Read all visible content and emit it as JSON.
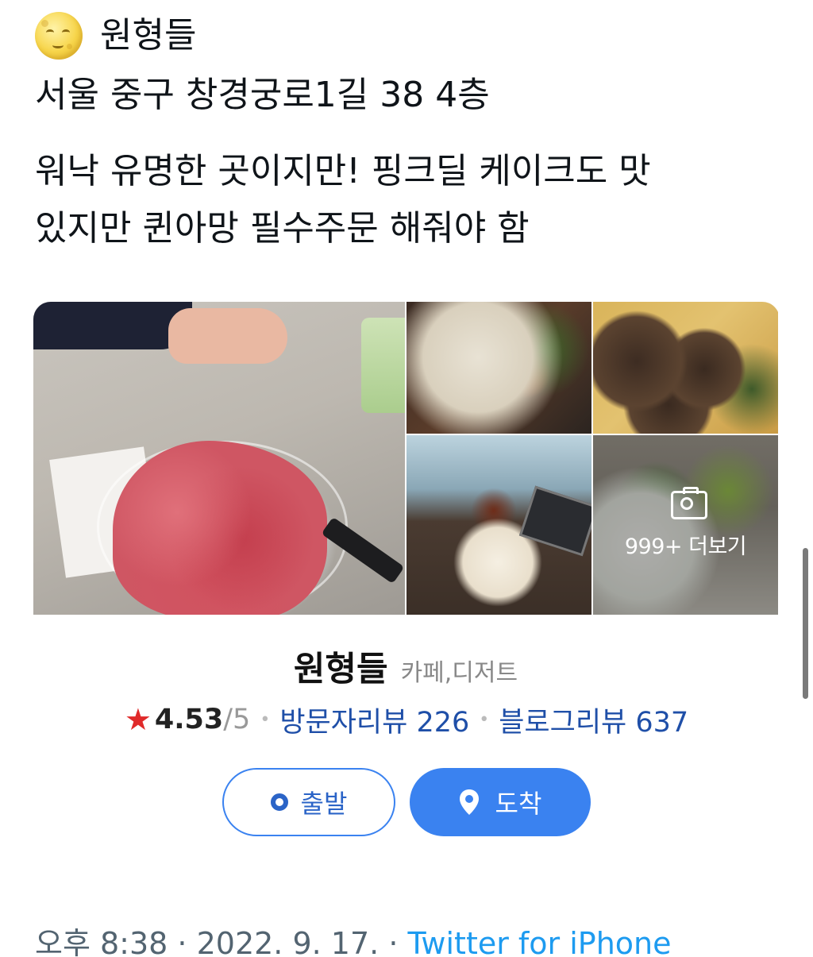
{
  "tweet": {
    "line1": "원형들",
    "address": "서울 중구 창경궁로1길 38 4층",
    "body_line1": "워낙 유명한 곳이지만! 핑크딜 케이크도 맛",
    "body_line2": "있지만 퀸아망 필수주문 해줘야 함"
  },
  "card": {
    "more_label": "999+ 더보기",
    "place_name": "원형들",
    "category": "카페,디저트",
    "rating": "4.53",
    "rating_max": "/5",
    "visitor_reviews": "방문자리뷰 226",
    "blog_reviews": "블로그리뷰 637",
    "start_label": "출발",
    "arrive_label": "도착"
  },
  "meta": {
    "time": "오후 8:38",
    "sep1": " · ",
    "date": "2022. 9. 17.",
    "sep2": " · ",
    "source": "Twitter for iPhone"
  },
  "icons": {
    "emoji": "full-moon-face-icon",
    "star": "star-icon",
    "camera": "camera-icon",
    "origin": "origin-marker-icon",
    "pin": "map-pin-icon"
  },
  "colors": {
    "accent_blue": "#3a82f0",
    "review_blue": "#1f4fa8",
    "star_red": "#e02a2a",
    "link_blue": "#1d9bf0",
    "meta_gray": "#536471"
  }
}
